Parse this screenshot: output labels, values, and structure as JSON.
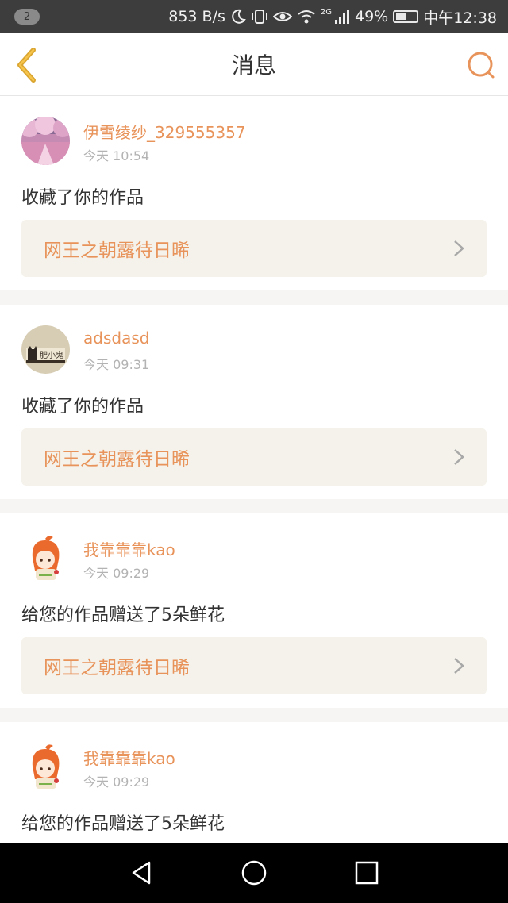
{
  "status_bar": {
    "notification_count": "2",
    "net_speed": "853 B/s",
    "signal_label": "2G",
    "battery_percent": "49%",
    "time": "中午12:38"
  },
  "header": {
    "title": "消息",
    "accent_color": "#e8935a"
  },
  "messages": [
    {
      "username": "伊雪绫纱_329555357",
      "time": "今天 10:54",
      "action": "收藏了你的作品",
      "work_title": "网王之朝露待日晞",
      "avatar": "cherry-blossom-avatar"
    },
    {
      "username": "adsdasd",
      "time": "今天 09:31",
      "action": "收藏了你的作品",
      "work_title": "网王之朝露待日晞",
      "avatar": "cat-sign-avatar",
      "avatar_text": "肥小鬼"
    },
    {
      "username": "我靠靠靠kao",
      "time": "今天 09:29",
      "action": "给您的作品赠送了5朵鲜花",
      "work_title": "网王之朝露待日晞",
      "avatar": "anime-girl-avatar"
    },
    {
      "username": "我靠靠靠kao",
      "time": "今天 09:29",
      "action": "给您的作品赠送了5朵鲜花",
      "avatar": "anime-girl-avatar"
    }
  ],
  "nav_bar": {
    "back": "triangle-back-icon",
    "home": "circle-home-icon",
    "recents": "square-recents-icon"
  }
}
